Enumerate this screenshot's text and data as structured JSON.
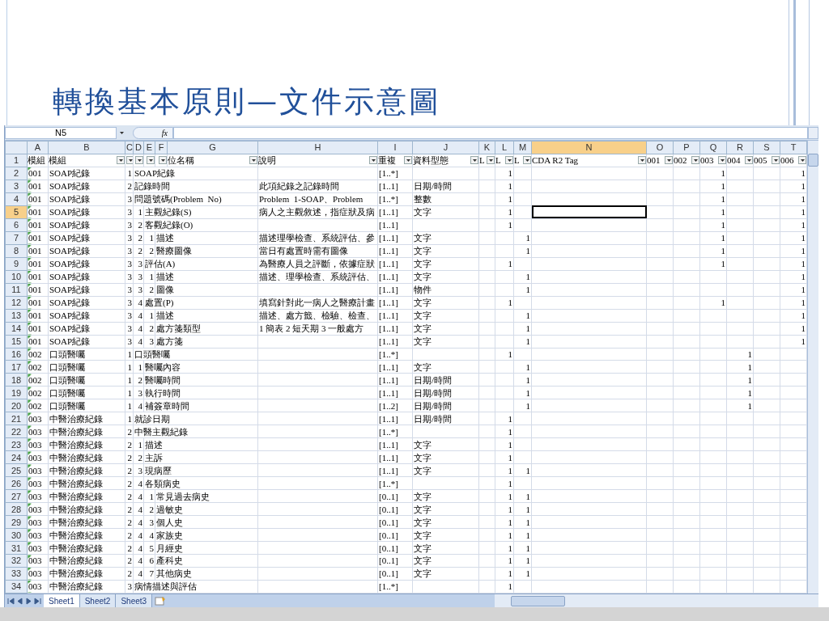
{
  "slide": {
    "title": "轉換基本原則—文件示意圖"
  },
  "formula_bar": {
    "name_box": "N5",
    "function_label": "fx"
  },
  "sheet": {
    "columns": [
      {
        "letter": "A",
        "selected": false,
        "header": "模組",
        "filter": false
      },
      {
        "letter": "B",
        "selected": false,
        "header": "模組",
        "filter": true
      },
      {
        "letter": "C",
        "selected": false,
        "filter": true
      },
      {
        "letter": "D",
        "selected": false,
        "filter": true
      },
      {
        "letter": "E",
        "selected": false,
        "filter": true
      },
      {
        "letter": "F",
        "selected": false,
        "filter": true
      },
      {
        "letter": "G",
        "selected": false,
        "header": "位名稱",
        "filter": true
      },
      {
        "letter": "H",
        "selected": false,
        "header": "說明",
        "filter": true
      },
      {
        "letter": "I",
        "selected": false,
        "header": "重複",
        "filter": true
      },
      {
        "letter": "J",
        "selected": false,
        "header": "資料型態",
        "filter": true
      },
      {
        "letter": "K",
        "selected": false,
        "header": "L",
        "filter": true
      },
      {
        "letter": "L",
        "selected": false,
        "header": "L",
        "filter": true
      },
      {
        "letter": "M",
        "selected": false,
        "header": "L",
        "filter": true
      },
      {
        "letter": "N",
        "selected": true,
        "header": "CDA R2 Tag",
        "filter": true
      },
      {
        "letter": "O",
        "selected": false,
        "header": "001",
        "filter": true
      },
      {
        "letter": "P",
        "selected": false,
        "header": "002",
        "filter": true
      },
      {
        "letter": "Q",
        "selected": false,
        "header": "003",
        "filter": true
      },
      {
        "letter": "R",
        "selected": false,
        "header": "004",
        "filter": true
      },
      {
        "letter": "S",
        "selected": false,
        "header": "005",
        "filter": true
      },
      {
        "letter": "T",
        "selected": false,
        "header": "006",
        "filter": true
      }
    ],
    "header_row_num": "1",
    "rows": [
      {
        "num": "2",
        "selected": false,
        "a": "001",
        "b": "SOAP紀錄",
        "levels": [
          "1"
        ],
        "name": "SOAP紀錄",
        "i": "[1..*]",
        "l": "1",
        "q": "1",
        "t": "1"
      },
      {
        "num": "3",
        "selected": false,
        "a": "001",
        "b": "SOAP紀錄",
        "levels": [
          "2"
        ],
        "name": "記錄時間",
        "h": "此項紀錄之記錄時間",
        "i": "[1..1]",
        "j": "日期/時間",
        "l": "1",
        "q": "1",
        "t": "1"
      },
      {
        "num": "4",
        "selected": false,
        "a": "001",
        "b": "SOAP紀錄",
        "levels": [
          "3"
        ],
        "name": "問題號碼(Problem  No)",
        "h": "Problem  1-SOAP、Problem",
        "i": "[1..*]",
        "j": "整數",
        "l": "1",
        "q": "1",
        "t": "1"
      },
      {
        "num": "5",
        "selected": true,
        "a": "001",
        "b": "SOAP紀錄",
        "levels": [
          "3",
          "1"
        ],
        "name": "主觀紀錄(S)",
        "h": "病人之主觀敘述，指症狀及病",
        "i": "[1..1]",
        "j": "文字",
        "l": "1",
        "q": "1",
        "t": "1"
      },
      {
        "num": "6",
        "selected": false,
        "a": "001",
        "b": "SOAP紀錄",
        "levels": [
          "3",
          "2"
        ],
        "name": "客觀紀錄(O)",
        "i": "[1..1]",
        "l": "1",
        "q": "1",
        "t": "1"
      },
      {
        "num": "7",
        "selected": false,
        "a": "001",
        "b": "SOAP紀錄",
        "levels": [
          "3",
          "2",
          "1"
        ],
        "name": "描述",
        "h": "描述理學檢查、系統評估、參",
        "i": "[1..1]",
        "j": "文字",
        "m": "1",
        "q": "1",
        "t": "1"
      },
      {
        "num": "8",
        "selected": false,
        "a": "001",
        "b": "SOAP紀錄",
        "levels": [
          "3",
          "2",
          "2"
        ],
        "name": "醫療圖像",
        "h": "當日有處置時需有圖像",
        "i": "[1..1]",
        "j": "文字",
        "m": "1",
        "q": "1",
        "t": "1"
      },
      {
        "num": "9",
        "selected": false,
        "a": "001",
        "b": "SOAP紀錄",
        "levels": [
          "3",
          "3"
        ],
        "name": "評估(A)",
        "h": "為醫療人員之評斷，依據症狀",
        "i": "[1..1]",
        "j": "文字",
        "l": "1",
        "q": "1",
        "t": "1"
      },
      {
        "num": "10",
        "selected": false,
        "a": "001",
        "b": "SOAP紀錄",
        "levels": [
          "3",
          "3",
          "1"
        ],
        "name": "描述",
        "h": "描述、理學檢查、系統評估、",
        "i": "[1..1]",
        "j": "文字",
        "m": "1",
        "t": "1"
      },
      {
        "num": "11",
        "selected": false,
        "a": "001",
        "b": "SOAP紀錄",
        "levels": [
          "3",
          "3",
          "2"
        ],
        "name": "圖像",
        "i": "[1..1]",
        "j": "物件",
        "m": "1",
        "t": "1"
      },
      {
        "num": "12",
        "selected": false,
        "a": "001",
        "b": "SOAP紀錄",
        "levels": [
          "3",
          "4"
        ],
        "name": "處置(P)",
        "h": "填寫針對此一病人之醫療計畫",
        "i": "[1..1]",
        "j": "文字",
        "l": "1",
        "q": "1",
        "t": "1"
      },
      {
        "num": "13",
        "selected": false,
        "a": "001",
        "b": "SOAP紀錄",
        "levels": [
          "3",
          "4",
          "1"
        ],
        "name": "描述",
        "h": "描述、處方籤、檢驗、檢查、",
        "i": "[1..1]",
        "j": "文字",
        "m": "1",
        "t": "1"
      },
      {
        "num": "14",
        "selected": false,
        "a": "001",
        "b": "SOAP紀錄",
        "levels": [
          "3",
          "4",
          "2"
        ],
        "name": "處方箋類型",
        "h": "1 簡表 2 短天期 3 一般處方",
        "i": "[1..1]",
        "j": "文字",
        "m": "1",
        "t": "1"
      },
      {
        "num": "15",
        "selected": false,
        "a": "001",
        "b": "SOAP紀錄",
        "levels": [
          "3",
          "4",
          "3"
        ],
        "name": "處方箋",
        "i": "[1..1]",
        "j": "文字",
        "m": "1",
        "t": "1"
      },
      {
        "num": "16",
        "selected": false,
        "a": "002",
        "b": "口頭醫囑",
        "levels": [
          "1"
        ],
        "name": "口頭醫囑",
        "i": "[1..*]",
        "l": "1",
        "r": "1"
      },
      {
        "num": "17",
        "selected": false,
        "a": "002",
        "b": "口頭醫囑",
        "levels": [
          "1",
          "1"
        ],
        "name": "醫囑內容",
        "i": "[1..1]",
        "j": "文字",
        "m": "1",
        "r": "1"
      },
      {
        "num": "18",
        "selected": false,
        "a": "002",
        "b": "口頭醫囑",
        "levels": [
          "1",
          "2"
        ],
        "name": "醫囑時間",
        "i": "[1..1]",
        "j": "日期/時間",
        "m": "1",
        "r": "1"
      },
      {
        "num": "19",
        "selected": false,
        "a": "002",
        "b": "口頭醫囑",
        "levels": [
          "1",
          "3"
        ],
        "name": "執行時間",
        "i": "[1..1]",
        "j": "日期/時間",
        "m": "1",
        "r": "1"
      },
      {
        "num": "20",
        "selected": false,
        "a": "002",
        "b": "口頭醫囑",
        "levels": [
          "1",
          "4"
        ],
        "name": "補簽章時間",
        "i": "[1..2]",
        "j": "日期/時間",
        "m": "1",
        "r": "1"
      },
      {
        "num": "21",
        "selected": false,
        "a": "003",
        "b": "中醫治療紀錄",
        "levels": [
          "1"
        ],
        "name": "就診日期",
        "i": "[1..1]",
        "j": "日期/時間",
        "l": "1"
      },
      {
        "num": "22",
        "selected": false,
        "a": "003",
        "b": "中醫治療紀錄",
        "levels": [
          "2"
        ],
        "name": "中醫主觀紀錄",
        "i": "[1..*]",
        "l": "1"
      },
      {
        "num": "23",
        "selected": false,
        "a": "003",
        "b": "中醫治療紀錄",
        "levels": [
          "2",
          "1"
        ],
        "name": "描述",
        "i": "[1..1]",
        "j": "文字",
        "l": "1"
      },
      {
        "num": "24",
        "selected": false,
        "a": "003",
        "b": "中醫治療紀錄",
        "levels": [
          "2",
          "2"
        ],
        "name": "主訴",
        "i": "[1..1]",
        "j": "文字",
        "l": "1"
      },
      {
        "num": "25",
        "selected": false,
        "a": "003",
        "b": "中醫治療紀錄",
        "levels": [
          "2",
          "3"
        ],
        "name": "現病歷",
        "i": "[1..1]",
        "j": "文字",
        "l": "1",
        "m": "1"
      },
      {
        "num": "26",
        "selected": false,
        "a": "003",
        "b": "中醫治療紀錄",
        "levels": [
          "2",
          "4"
        ],
        "name": "各類病史",
        "i": "[1..*]",
        "l": "1"
      },
      {
        "num": "27",
        "selected": false,
        "a": "003",
        "b": "中醫治療紀錄",
        "levels": [
          "2",
          "4",
          "1"
        ],
        "name": "常見過去病史",
        "i": "[0..1]",
        "j": "文字",
        "l": "1",
        "m": "1"
      },
      {
        "num": "28",
        "selected": false,
        "a": "003",
        "b": "中醫治療紀錄",
        "levels": [
          "2",
          "4",
          "2"
        ],
        "name": "過敏史",
        "i": "[0..1]",
        "j": "文字",
        "l": "1",
        "m": "1"
      },
      {
        "num": "29",
        "selected": false,
        "a": "003",
        "b": "中醫治療紀錄",
        "levels": [
          "2",
          "4",
          "3"
        ],
        "name": "個人史",
        "i": "[0..1]",
        "j": "文字",
        "l": "1",
        "m": "1"
      },
      {
        "num": "30",
        "selected": false,
        "a": "003",
        "b": "中醫治療紀錄",
        "levels": [
          "2",
          "4",
          "4"
        ],
        "name": "家族史",
        "i": "[0..1]",
        "j": "文字",
        "l": "1",
        "m": "1"
      },
      {
        "num": "31",
        "selected": false,
        "a": "003",
        "b": "中醫治療紀錄",
        "levels": [
          "2",
          "4",
          "5"
        ],
        "name": "月經史",
        "i": "[0..1]",
        "j": "文字",
        "l": "1",
        "m": "1"
      },
      {
        "num": "32",
        "selected": false,
        "a": "003",
        "b": "中醫治療紀錄",
        "levels": [
          "2",
          "4",
          "6"
        ],
        "name": "產科史",
        "i": "[0..1]",
        "j": "文字",
        "l": "1",
        "m": "1"
      },
      {
        "num": "33",
        "selected": false,
        "a": "003",
        "b": "中醫治療紀錄",
        "levels": [
          "2",
          "4",
          "7"
        ],
        "name": "其他病史",
        "i": "[0..1]",
        "j": "文字",
        "l": "1",
        "m": "1"
      },
      {
        "num": "34",
        "selected": false,
        "a": "003",
        "b": "中醫治療紀錄",
        "levels": [
          "3"
        ],
        "name": "病情描述與評估",
        "i": "[1..*]",
        "l": "1"
      }
    ]
  },
  "sheet_tabs": [
    {
      "label": "Sheet1",
      "selected": true
    },
    {
      "label": "Sheet2",
      "selected": false
    },
    {
      "label": "Sheet3",
      "selected": false
    }
  ]
}
